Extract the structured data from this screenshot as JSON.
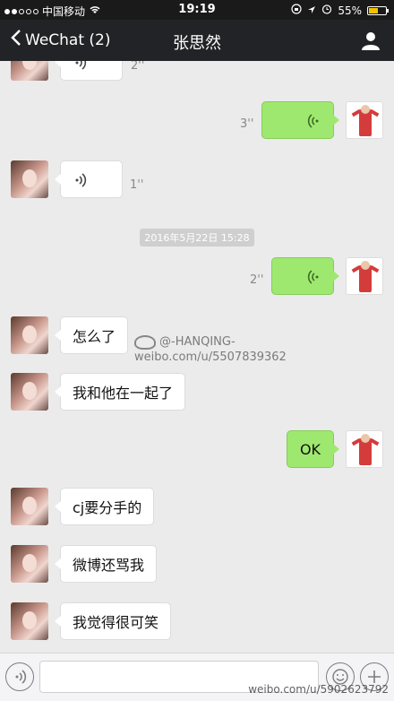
{
  "status_bar": {
    "carrier": "中国移动",
    "time": "19:19",
    "battery_percent": "55%",
    "battery_level": 0.55,
    "signal_dots": [
      true,
      true,
      false,
      false,
      false
    ]
  },
  "nav": {
    "back_label": "WeChat (2)",
    "title": "张思然"
  },
  "messages": {
    "m1_duration": "2''",
    "m2_duration": "3''",
    "m3_duration": "1''",
    "timestamp": "2016年5月22日 15:28",
    "m4_duration": "2''",
    "m5_text": "怎么了",
    "m6_text": "我和他在一起了",
    "m7_text": "OK",
    "m8_text": "cj要分手的",
    "m9_text": "微博还骂我",
    "m10_text": "我觉得很可笑"
  },
  "watermark": {
    "name": "@-HANQING-",
    "url": "weibo.com/u/5507839362"
  },
  "watermark_bottom": {
    "url": "weibo.com/u/5902623792"
  },
  "colors": {
    "nav_bg": "#222326",
    "chat_bg": "#ebebeb",
    "bubble_self": "#9fe870",
    "bubble_other": "#ffffff"
  }
}
